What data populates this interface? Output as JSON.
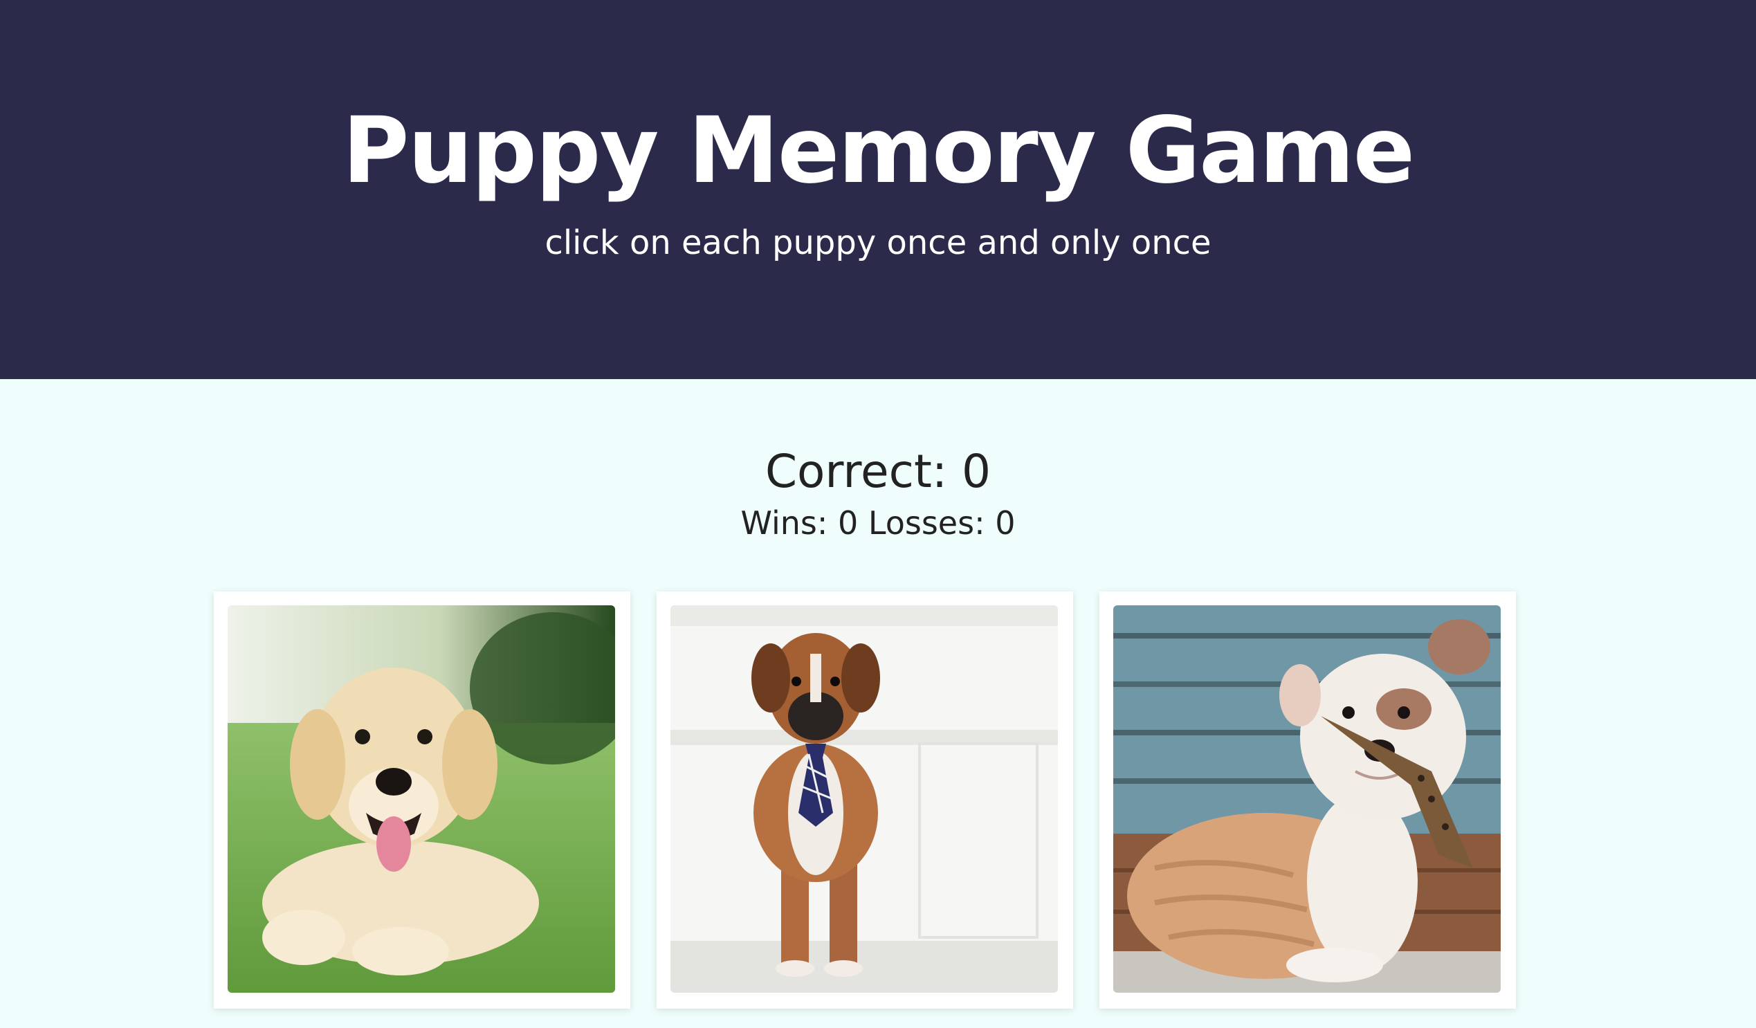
{
  "header": {
    "title": "Puppy Memory Game",
    "subtitle": "click on each puppy once and only once"
  },
  "scoreboard": {
    "correct_label": "Correct: 0",
    "wins_label": "Wins: 0",
    "losses_label": "Losses: 0"
  },
  "cards": [
    {
      "name": "golden-retriever-puppy"
    },
    {
      "name": "boxer-puppy-with-tie"
    },
    {
      "name": "bulldog-puppy-with-scarf"
    }
  ],
  "colors": {
    "header_bg": "#2c2a4b",
    "page_bg": "#effdfc",
    "text": "#222222"
  }
}
